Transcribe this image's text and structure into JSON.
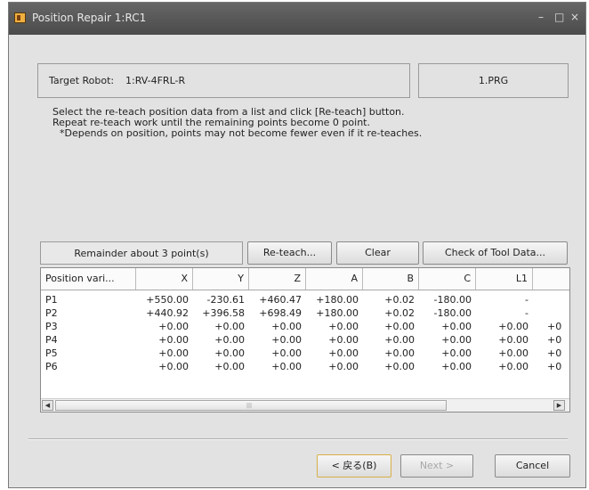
{
  "window": {
    "title": "Position Repair 1:RC1",
    "controls": {
      "minimize": "–",
      "maximize": "□",
      "close": "×"
    }
  },
  "target": {
    "label": "Target Robot:",
    "value": "1:RV-4FRL-R",
    "program": "1.PRG"
  },
  "instructions": [
    "Select the re-teach position data from a list and click [Re-teach] button.",
    "Repeat re-teach work until the remaining points become 0 point.",
    "*Depends on position, points may not become fewer even if it re-teaches."
  ],
  "remainder": "Remainder about 3 point(s)",
  "buttons": {
    "reteach": "Re-teach...",
    "clear": "Clear",
    "check_tool": "Check of Tool Data...",
    "back": "< 戻る(B)",
    "next": "Next >",
    "cancel": "Cancel"
  },
  "table": {
    "columns": [
      "Position vari...",
      "X",
      "Y",
      "Z",
      "A",
      "B",
      "C",
      "L1",
      ""
    ],
    "rows": [
      [
        "P1",
        "+550.00",
        "-230.61",
        "+460.47",
        "+180.00",
        "+0.02",
        "-180.00",
        "-",
        ""
      ],
      [
        "P2",
        "+440.92",
        "+396.58",
        "+698.49",
        "+180.00",
        "+0.02",
        "-180.00",
        "-",
        ""
      ],
      [
        "P3",
        "+0.00",
        "+0.00",
        "+0.00",
        "+0.00",
        "+0.00",
        "+0.00",
        "+0.00",
        "+0"
      ],
      [
        "P4",
        "+0.00",
        "+0.00",
        "+0.00",
        "+0.00",
        "+0.00",
        "+0.00",
        "+0.00",
        "+0"
      ],
      [
        "P5",
        "+0.00",
        "+0.00",
        "+0.00",
        "+0.00",
        "+0.00",
        "+0.00",
        "+0.00",
        "+0"
      ],
      [
        "P6",
        "+0.00",
        "+0.00",
        "+0.00",
        "+0.00",
        "+0.00",
        "+0.00",
        "+0.00",
        "+0"
      ]
    ]
  },
  "icons": {
    "app": "app-icon",
    "scroll_left": "scroll-left-arrow-icon",
    "scroll_right": "scroll-right-arrow-icon"
  }
}
